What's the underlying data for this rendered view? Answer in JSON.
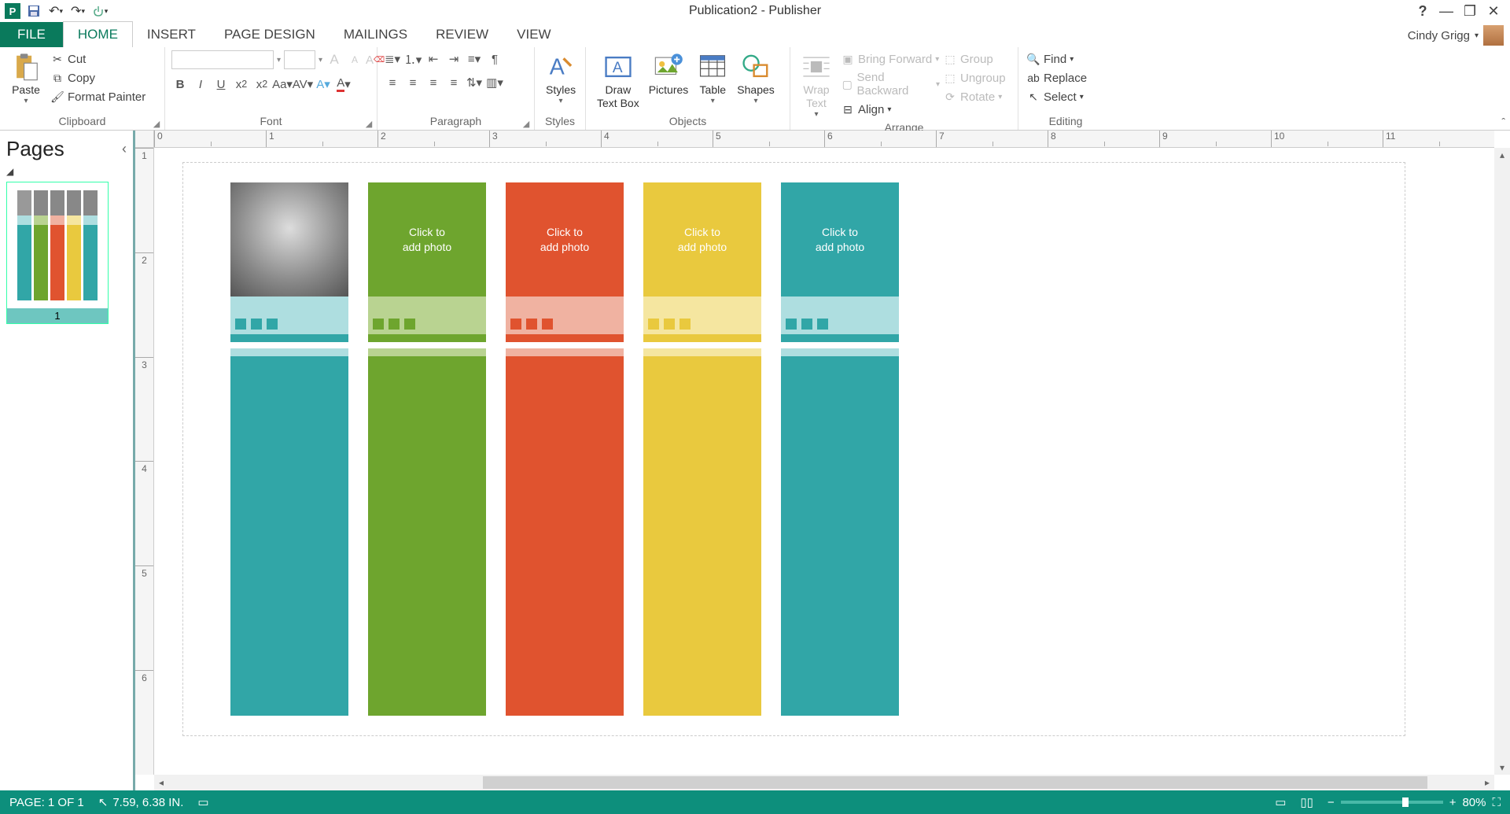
{
  "title": "Publication2 - Publisher",
  "user": {
    "name": "Cindy Grigg"
  },
  "qat": {
    "save": "Save",
    "undo": "Undo",
    "redo": "Redo",
    "touch": "Touch/Mouse Mode"
  },
  "tabs": {
    "file": "FILE",
    "items": [
      "HOME",
      "INSERT",
      "PAGE DESIGN",
      "MAILINGS",
      "REVIEW",
      "VIEW"
    ],
    "active": "HOME"
  },
  "ribbon": {
    "clipboard": {
      "paste": "Paste",
      "cut": "Cut",
      "copy": "Copy",
      "format_painter": "Format Painter",
      "label": "Clipboard"
    },
    "font": {
      "label": "Font",
      "grow": "A",
      "shrink": "A",
      "clear": "✕",
      "name_placeholder": "",
      "size_placeholder": ""
    },
    "paragraph": {
      "label": "Paragraph"
    },
    "styles": {
      "label": "Styles",
      "btn": "Styles"
    },
    "objects": {
      "label": "Objects",
      "draw": "Draw\nText Box",
      "pictures": "Pictures",
      "table": "Table",
      "shapes": "Shapes"
    },
    "arrange": {
      "label": "Arrange",
      "wrap": "Wrap\nText",
      "bring": "Bring Forward",
      "send": "Send Backward",
      "align": "Align",
      "group": "Group",
      "ungroup": "Ungroup",
      "rotate": "Rotate"
    },
    "editing": {
      "label": "Editing",
      "find": "Find",
      "replace": "Replace",
      "select": "Select"
    }
  },
  "pages_panel": {
    "title": "Pages",
    "page_num": "1"
  },
  "placeholder_text": "Click to\nadd photo",
  "strips": [
    {
      "photo_has_image": true,
      "main": "teal-main",
      "light": "teal-light",
      "photo": "teal-photo"
    },
    {
      "photo_has_image": false,
      "main": "green-main",
      "light": "green-light",
      "photo": "green-photo"
    },
    {
      "photo_has_image": false,
      "main": "orange-main",
      "light": "orange-light",
      "photo": "orange-photo"
    },
    {
      "photo_has_image": false,
      "main": "yellow-main",
      "light": "yellow-light",
      "photo": "yellow-photo"
    },
    {
      "photo_has_image": false,
      "main": "teal-main",
      "light": "teal-light",
      "photo": "teal-photo"
    }
  ],
  "ruler_h": [
    "0",
    "1",
    "2",
    "3",
    "4",
    "5",
    "6",
    "7",
    "8",
    "9",
    "10",
    "11"
  ],
  "ruler_v": [
    "1",
    "2",
    "3",
    "4",
    "5",
    "6"
  ],
  "status": {
    "page": "PAGE: 1 OF 1",
    "pos": "7.59, 6.38 IN.",
    "zoom": "80%",
    "minus": "−",
    "plus": "+"
  }
}
